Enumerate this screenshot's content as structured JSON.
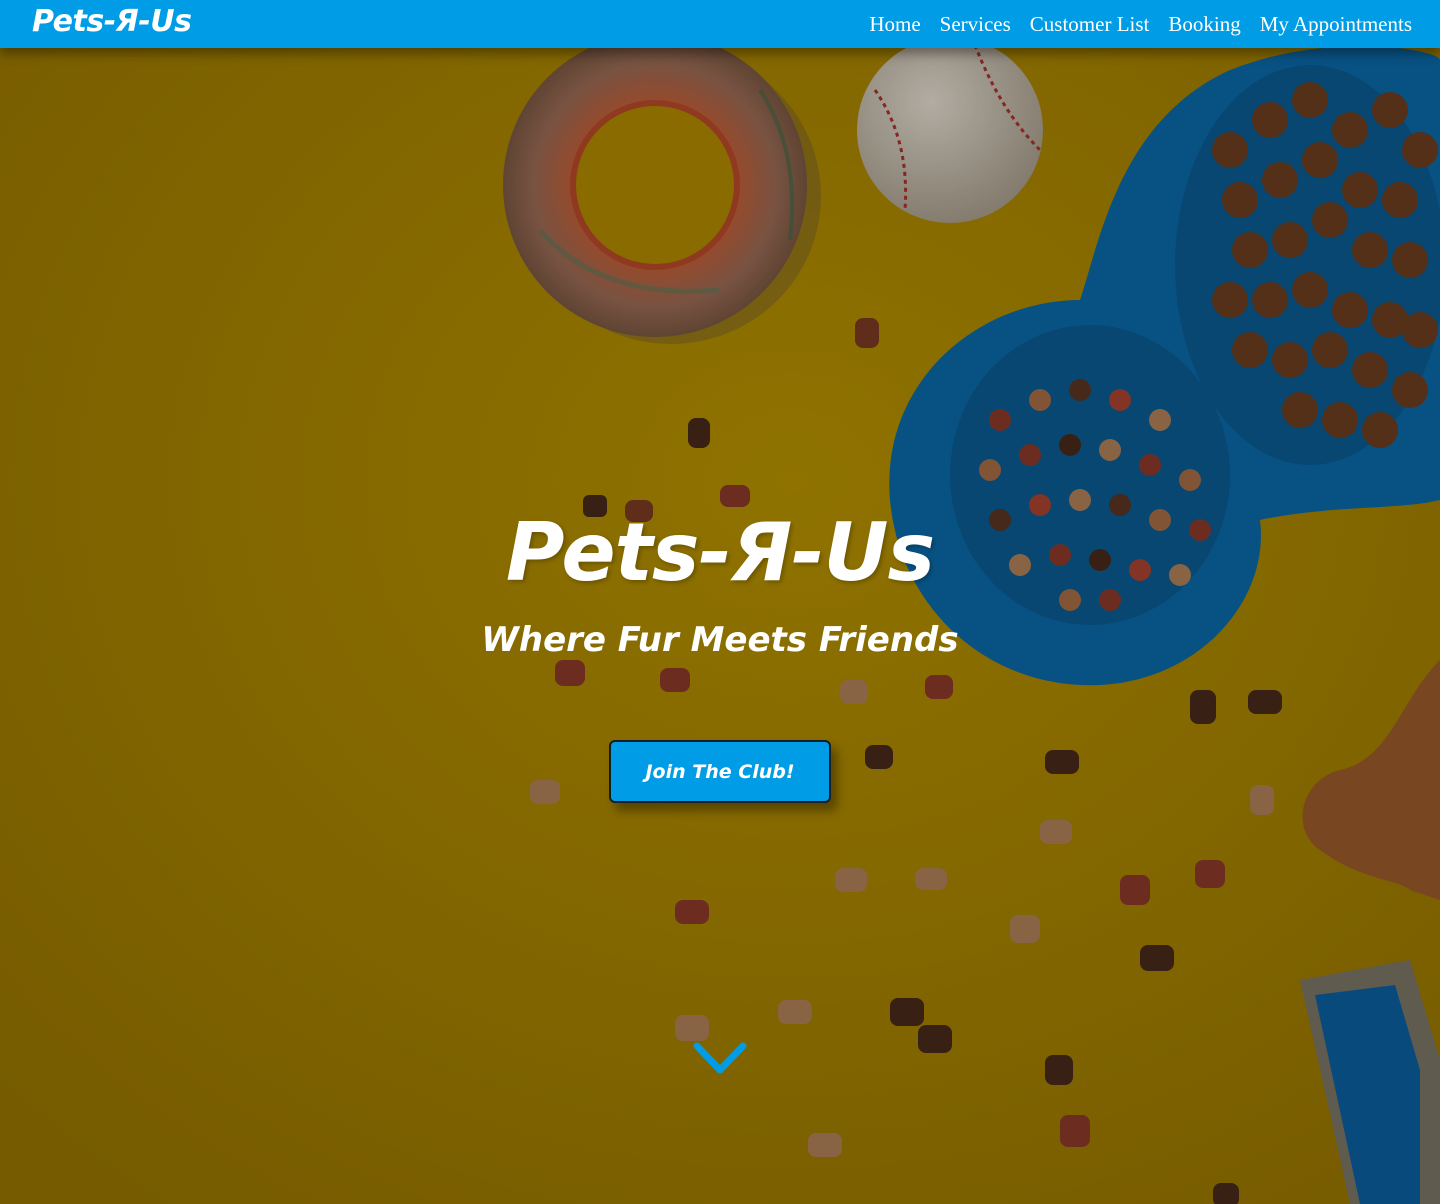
{
  "navbar": {
    "brand": "Pets-Я-Us",
    "links": [
      "Home",
      "Services",
      "Customer List",
      "Booking",
      "My Appointments"
    ]
  },
  "hero": {
    "title": "Pets-Я-Us",
    "subtitle": "Where Fur Meets Friends",
    "cta_label": "Join The Club!",
    "scroll_icon": "chevron-down-icon"
  },
  "colors": {
    "primary": "#009de6",
    "background": "#a88500",
    "text": "#ffffff"
  }
}
